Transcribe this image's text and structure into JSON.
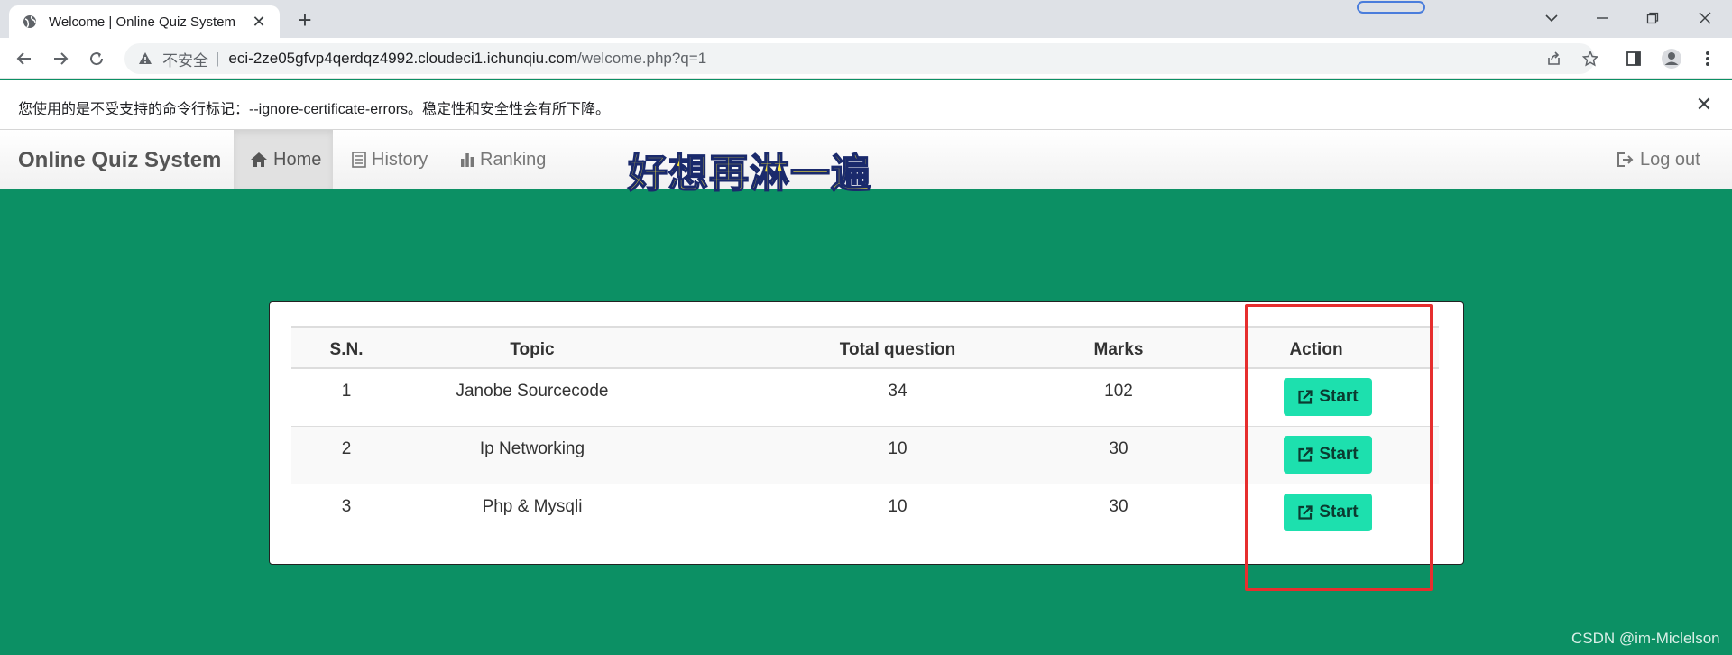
{
  "browser": {
    "tab_title": "Welcome | Online Quiz System",
    "tab_close": "✕",
    "new_tab": "+",
    "address": {
      "insecure_label": "不安全",
      "separator": "|",
      "host": "eci-2ze05gfvp4qerdqz4992.cloudeci1.ichunqiu.com",
      "path": "/welcome.php?q=1"
    },
    "infobar": {
      "message": "您使用的是不受支持的命令行标记：--ignore-certificate-errors。稳定性和安全性会有所下降。",
      "close": "✕"
    }
  },
  "site": {
    "brand": "Online Quiz System",
    "nav": [
      {
        "label": "Home",
        "icon": "home-icon",
        "active": true
      },
      {
        "label": "History",
        "icon": "list-icon",
        "active": false
      },
      {
        "label": "Ranking",
        "icon": "bar-chart-icon",
        "active": false
      }
    ],
    "logout_label": "Log out",
    "overlay_text": "好想再淋一遍"
  },
  "table": {
    "headers": [
      "S.N.",
      "Topic",
      "Total question",
      "Marks",
      "Action"
    ],
    "rows": [
      {
        "sn": "1",
        "topic": "Janobe Sourcecode",
        "total": "34",
        "marks": "102",
        "action": "Start"
      },
      {
        "sn": "2",
        "topic": "Ip Networking",
        "total": "10",
        "marks": "30",
        "action": "Start"
      },
      {
        "sn": "3",
        "topic": "Php & Mysqli",
        "total": "10",
        "marks": "30",
        "action": "Start"
      }
    ]
  },
  "watermark": "CSDN @im-Miclelson",
  "colors": {
    "page_bg": "#0c9064",
    "start_button": "#1de0ae",
    "highlight_box": "#e62e2e"
  }
}
